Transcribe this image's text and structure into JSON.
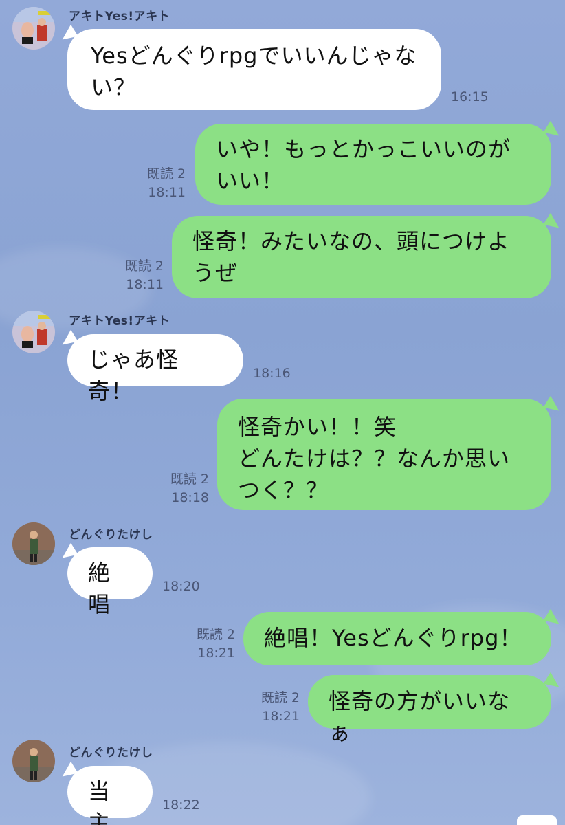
{
  "chat": {
    "messages": [
      {
        "direction": "in",
        "sender": "アキトYes!アキト",
        "avatar": "person-photo-avatar",
        "text": "Yesどんぐりrpgでいいんじゃない？",
        "time": "16:15"
      },
      {
        "direction": "out",
        "text": "いや！もっとかっこいいのがいい！",
        "read": "既読 2",
        "time": "18:11"
      },
      {
        "direction": "out",
        "text": "怪奇！みたいなの、頭につけようぜ",
        "read": "既読 2",
        "time": "18:11"
      },
      {
        "direction": "in",
        "sender": "アキトYes!アキト",
        "avatar": "person-photo-avatar",
        "text": "じゃあ怪奇！",
        "time": "18:16"
      },
      {
        "direction": "out",
        "text": "怪奇かい！！笑\nどんたけは？？なんか思いつく？？",
        "read": "既読 2",
        "time": "18:18"
      },
      {
        "direction": "in",
        "sender": "どんぐりたけし",
        "avatar": "person-photo-avatar",
        "text": "絶唱",
        "time": "18:20"
      },
      {
        "direction": "out",
        "text": "絶唱！Yesどんぐりrpg！",
        "read": "既読 2",
        "time": "18:21"
      },
      {
        "direction": "out",
        "text": "怪奇の方がいいなぁ",
        "read": "既読 2",
        "time": "18:21"
      },
      {
        "direction": "in",
        "sender": "どんぐりたけし",
        "avatar": "person-photo-avatar",
        "text": "当主",
        "time": "18:22"
      }
    ]
  },
  "colors": {
    "background": "#8fa8d6",
    "incoming_bubble": "#ffffff",
    "outgoing_bubble": "#8ce085",
    "meta_text": "#4a5676"
  }
}
